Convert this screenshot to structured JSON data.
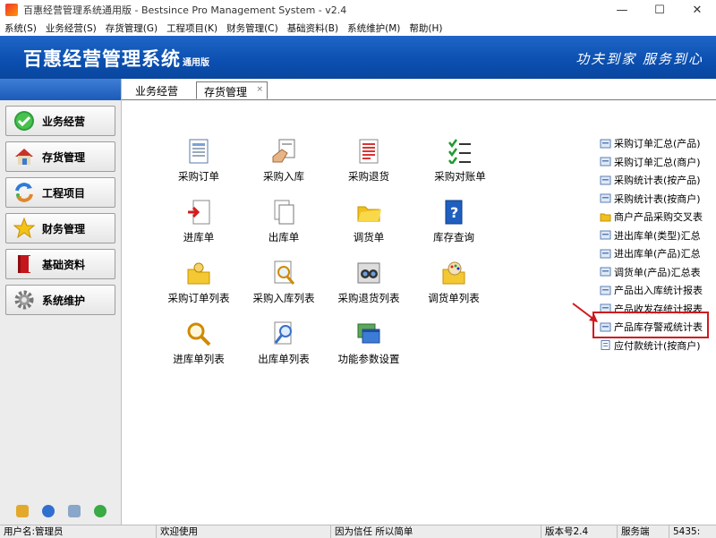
{
  "window": {
    "title": "百惠经营管理系统通用版 - Bestsince Pro Management System - v2.4"
  },
  "menu": [
    "系统(S)",
    "业务经营(S)",
    "存货管理(G)",
    "工程项目(K)",
    "财务管理(C)",
    "基础资料(B)",
    "系统维护(M)",
    "帮助(H)"
  ],
  "banner": {
    "app_name": "百惠经营管理系统",
    "edition": "通用版",
    "slogan": "功夫到家 服务到心"
  },
  "sidebar": {
    "items": [
      {
        "label": "业务经营",
        "icon": "check-circle-icon"
      },
      {
        "label": "存货管理",
        "icon": "house-icon"
      },
      {
        "label": "工程项目",
        "icon": "recycle-arrows-icon"
      },
      {
        "label": "财务管理",
        "icon": "star-icon"
      },
      {
        "label": "基础资料",
        "icon": "book-icon"
      },
      {
        "label": "系统维护",
        "icon": "gear-icon"
      }
    ]
  },
  "tabs": [
    {
      "label": "业务经营",
      "active": false
    },
    {
      "label": "存货管理",
      "active": true,
      "close": "×"
    }
  ],
  "functions": [
    {
      "label": "采购订单",
      "icon": "document-list-icon"
    },
    {
      "label": "采购入库",
      "icon": "hand-document-icon"
    },
    {
      "label": "采购退货",
      "icon": "red-document-icon"
    },
    {
      "label": "采购对账单",
      "icon": "checklist-icon"
    },
    {
      "label": "进库单",
      "icon": "document-arrow-in-icon"
    },
    {
      "label": "出库单",
      "icon": "documents-icon"
    },
    {
      "label": "调货单",
      "icon": "folder-icon"
    },
    {
      "label": "库存查询",
      "icon": "help-book-icon"
    },
    {
      "label": "采购订单列表",
      "icon": "folder-person-icon"
    },
    {
      "label": "采购入库列表",
      "icon": "document-search-icon"
    },
    {
      "label": "采购退货列表",
      "icon": "binoculars-icon"
    },
    {
      "label": "调货单列表",
      "icon": "palette-folder-icon"
    },
    {
      "label": "进库单列表",
      "icon": "magnifier-icon"
    },
    {
      "label": "出库单列表",
      "icon": "document-magnifier-icon"
    },
    {
      "label": "功能参数设置",
      "icon": "windows-icon"
    }
  ],
  "reports": [
    {
      "label": "采购订单汇总(产品)",
      "icon": "report-icon"
    },
    {
      "label": "采购订单汇总(商户)",
      "icon": "report-icon"
    },
    {
      "label": "采购统计表(按产品)",
      "icon": "report-icon"
    },
    {
      "label": "采购统计表(按商户)",
      "icon": "report-icon"
    },
    {
      "label": "商户产品采购交叉表",
      "icon": "folder-icon"
    },
    {
      "label": "进出库单(类型)汇总",
      "icon": "report-icon"
    },
    {
      "label": "进出库单(产品)汇总",
      "icon": "report-icon"
    },
    {
      "label": "调货单(产品)汇总表",
      "icon": "report-icon"
    },
    {
      "label": "产品出入库统计报表",
      "icon": "report-icon"
    },
    {
      "label": "产品收发存统计报表",
      "icon": "report-icon"
    },
    {
      "label": "产品库存警戒统计表",
      "icon": "report-icon"
    },
    {
      "label": "应付款统计(按商户)",
      "icon": "document-icon"
    }
  ],
  "status": {
    "user": "用户名:管理员",
    "welcome": "欢迎使用",
    "motto": "因为信任 所以简单",
    "version": "版本号2.4",
    "server": "服务端",
    "port": "5435:"
  },
  "colors": {
    "banner": "#0b4fb0",
    "highlight": "#d0191d",
    "sidebar": "#ececec"
  }
}
